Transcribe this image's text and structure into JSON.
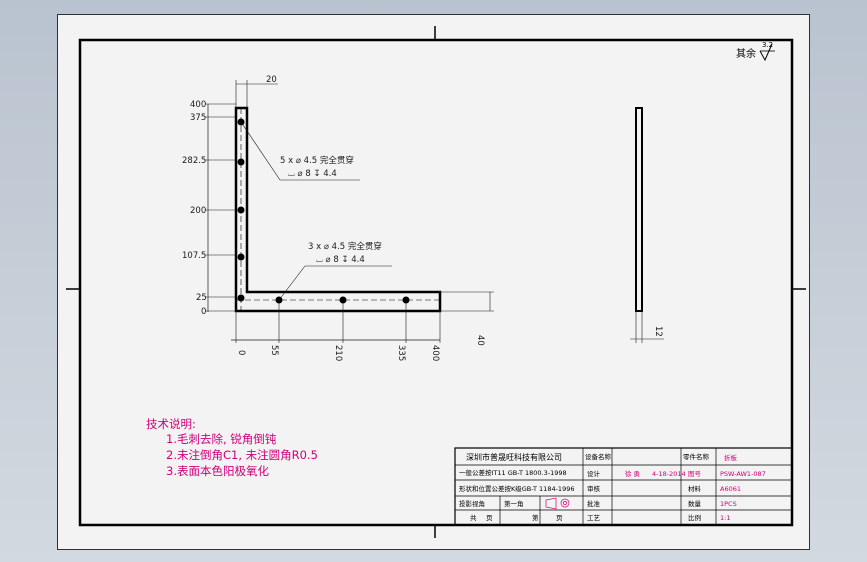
{
  "surface_finish": {
    "label": "其余",
    "value": "3.2"
  },
  "dimensions": {
    "top_width": "20",
    "y_ticks": [
      "400",
      "375",
      "282.5",
      "200",
      "107.5",
      "25",
      "0"
    ],
    "x_ticks": [
      "0",
      "55",
      "210",
      "335",
      "400"
    ],
    "leg_height": "40",
    "thickness": "12"
  },
  "hole_callouts": [
    {
      "line1": "5 x  ⌀ 4.5 完全贯穿",
      "line2": "⌴ ⌀ 8 ↧ 4.4"
    },
    {
      "line1": "3 x  ⌀ 4.5 完全贯穿",
      "line2": "⌴ ⌀ 8 ↧ 4.4"
    }
  ],
  "technical_notes": {
    "title": "技术说明:",
    "items": [
      "1.毛刺去除, 锐角倒钝",
      "2.未注倒角C1, 未注圆角R0.5",
      "3.表面本色阳极氧化"
    ]
  },
  "title_block": {
    "company": "深圳市普晟旺科技有限公司",
    "general_tol": "一般公差按IT11 GB-T 1800.3-1998",
    "geo_tol": "形状和位置公差按K级GB-T 1184-1996",
    "projection": "投影视角",
    "first_angle": "第一角",
    "total_label": "共",
    "sheets_label": "页",
    "sheet_label": "第",
    "page_label": "页",
    "device_name_label": "设备名称",
    "part_name_label": "零件名称",
    "part_name": "折板",
    "design_label": "设计",
    "check_label": "审核",
    "approve_label": "批准",
    "process_label": "工艺",
    "material_label": "材料",
    "qty_label": "数量",
    "scale_label": "比例",
    "designer": "徐 勇",
    "date": "4-18-2014",
    "material": "A6061",
    "quantity": "1PCS",
    "scale": "1:1",
    "drawing_no": "PSW-AW1-087",
    "pink_label": "图号"
  },
  "colors": {
    "accent": "#d0007a",
    "line": "#000000",
    "dim": "#1a1a1a"
  }
}
